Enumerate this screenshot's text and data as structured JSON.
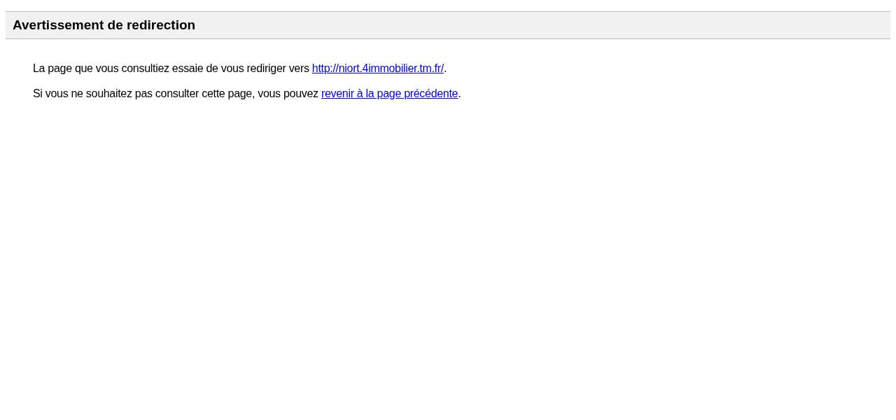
{
  "header": {
    "title": "Avertissement de redirection"
  },
  "paragraphs": [
    {
      "before": "La page que vous consultiez essaie de vous rediriger vers ",
      "link": "http://niort.4immobilier.tm.fr/",
      "after": "."
    },
    {
      "before": "Si vous ne souhaitez pas consulter cette page, vous pouvez ",
      "link": "revenir à la page précédente",
      "after": "."
    }
  ]
}
